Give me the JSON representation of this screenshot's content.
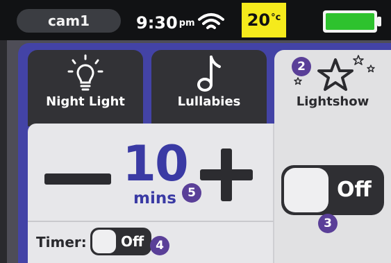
{
  "status_bar": {
    "camera_label": "cam1",
    "time": "9:30",
    "time_suffix": "pm",
    "temperature": "20",
    "temperature_unit": "°c",
    "battery_color": "#2ec22e"
  },
  "tabs": [
    {
      "label": "Night Light",
      "icon": "lightbulb-icon"
    },
    {
      "label": "Lullabies",
      "icon": "music-note-icon"
    },
    {
      "label": "Lightshow",
      "icon": "star-icon"
    }
  ],
  "timer": {
    "value": "10",
    "unit": "mins",
    "label": "Timer:",
    "toggle_state": "Off"
  },
  "lightshow": {
    "toggle_state": "Off"
  },
  "callouts": {
    "c2": "2",
    "c3": "3",
    "c4": "4",
    "c5": "5"
  },
  "colors": {
    "accent_purple": "#4343a6",
    "number_blue": "#3a3aa4",
    "callout_purple": "#5a3f98",
    "temp_yellow": "#f5ea1c"
  }
}
